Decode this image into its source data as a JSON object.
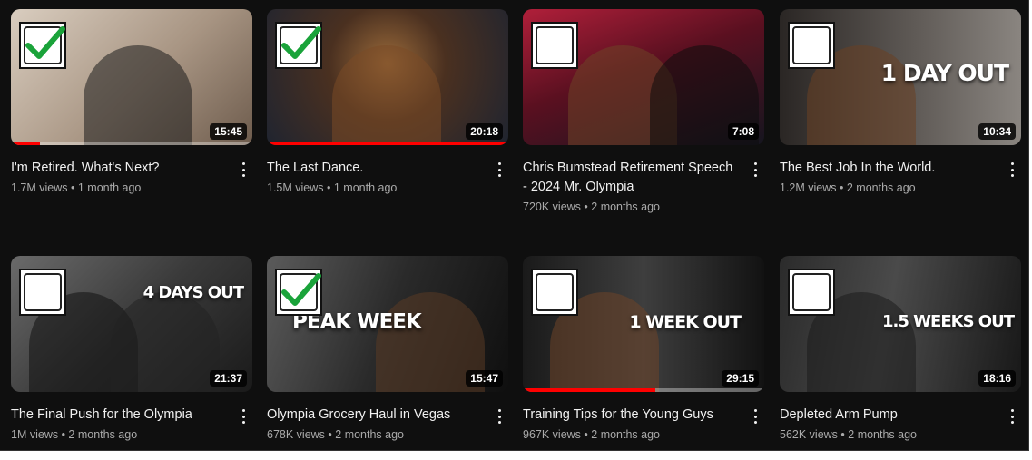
{
  "videos": [
    {
      "title": "I'm Retired. What's Next?",
      "views": "1.7M views",
      "age": "1 month ago",
      "duration": "15:45",
      "checked": true,
      "watched": 0.12,
      "overlay": "",
      "bg": [
        "#c8b8a6",
        "#8d7764"
      ]
    },
    {
      "title": "The Last Dance.",
      "views": "1.5M views",
      "age": "1 month ago",
      "duration": "20:18",
      "checked": true,
      "watched": 1.0,
      "overlay": "",
      "bg": [
        "#3a3f4a",
        "#6b4a2e"
      ]
    },
    {
      "title": "Chris Bumstead Retirement Speech - 2024 Mr. Olympia",
      "views": "720K views",
      "age": "2 months ago",
      "duration": "7:08",
      "checked": false,
      "watched": 0,
      "overlay": "",
      "bg": [
        "#7a1b2b",
        "#1d1d2e"
      ]
    },
    {
      "title": "The Best Job In the World.",
      "views": "1.2M views",
      "age": "2 months ago",
      "duration": "10:34",
      "checked": false,
      "watched": 0,
      "overlay": "1 DAY OUT",
      "bg": [
        "#6b6b6b",
        "#2e2a28"
      ]
    },
    {
      "title": "The Final Push for the Olympia",
      "views": "1M views",
      "age": "2 months ago",
      "duration": "21:37",
      "checked": false,
      "watched": 0,
      "overlay": "4 DAYS OUT",
      "bg": [
        "#5a5a5a",
        "#1e1e1e"
      ]
    },
    {
      "title": "Olympia Grocery Haul in Vegas",
      "views": "678K views",
      "age": "2 months ago",
      "duration": "15:47",
      "checked": true,
      "watched": 0,
      "overlay": "PEAK WEEK",
      "bg": [
        "#4a4a4a",
        "#171717"
      ]
    },
    {
      "title": "Training Tips for the Young Guys",
      "views": "967K views",
      "age": "2 months ago",
      "duration": "29:15",
      "checked": false,
      "watched": 0.55,
      "overlay": "1 WEEK OUT",
      "bg": [
        "#3a3a3a",
        "#121212"
      ]
    },
    {
      "title": "Depleted Arm Pump",
      "views": "562K views",
      "age": "2 months ago",
      "duration": "18:16",
      "checked": false,
      "watched": 0,
      "overlay": "1.5 WEEKS OUT",
      "bg": [
        "#3d3d3d",
        "#151515"
      ]
    }
  ],
  "colors": {
    "background": "#0f0f0f",
    "accent": "#ff0000",
    "check": "#1aa33a"
  }
}
